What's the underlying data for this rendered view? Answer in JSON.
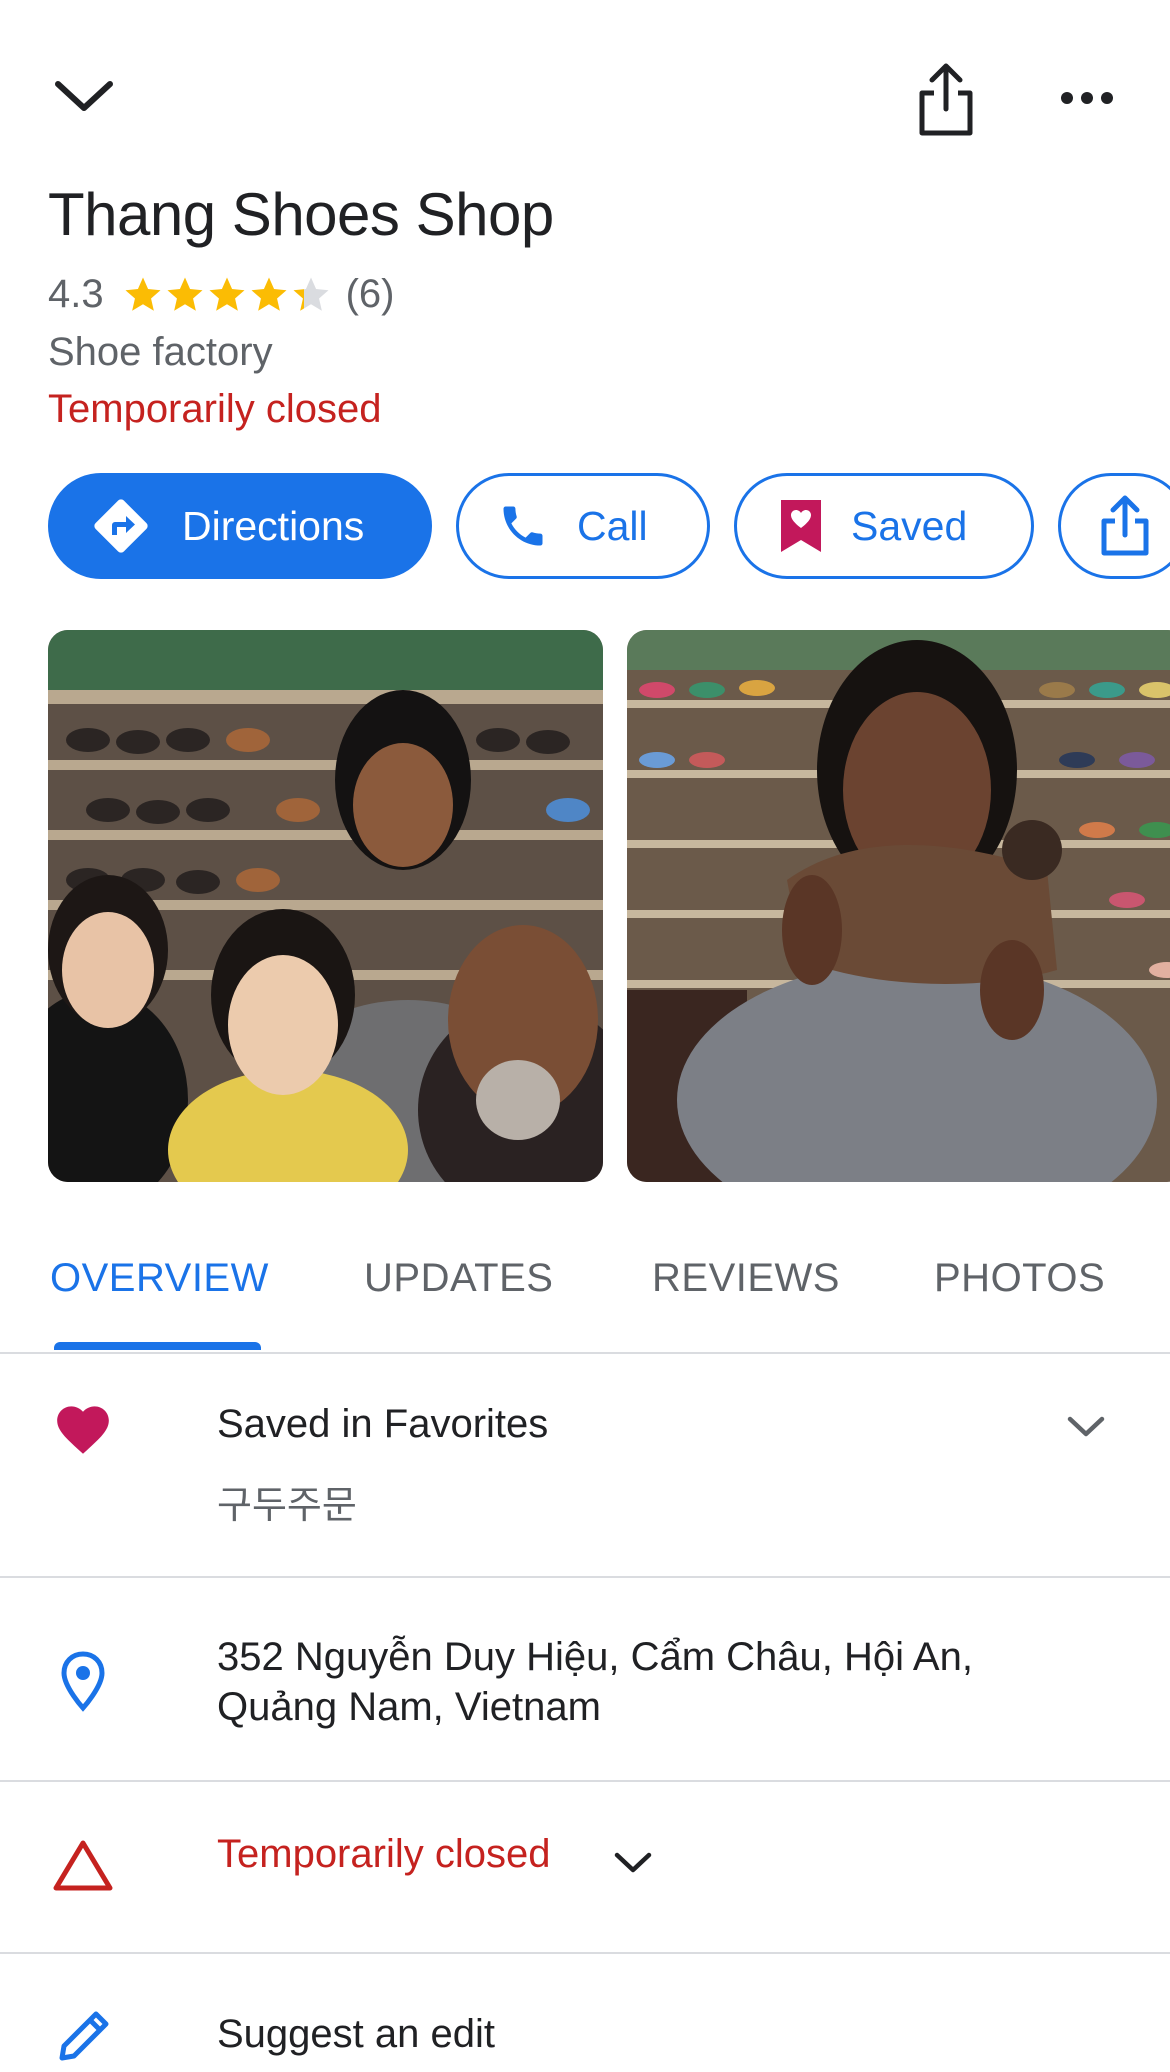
{
  "place": {
    "name": "Thang Shoes Shop",
    "rating": "4.3",
    "rating_value": 4.3,
    "rating_max": 5,
    "review_count": "(6)",
    "category": "Shoe factory",
    "status": "Temporarily closed"
  },
  "actions": {
    "directions": "Directions",
    "call": "Call",
    "saved": "Saved"
  },
  "tabs": [
    "OVERVIEW",
    "UPDATES",
    "REVIEWS",
    "PHOTOS"
  ],
  "active_tab": "OVERVIEW",
  "saved_list": {
    "title": "Saved in Favorites",
    "note": "구두주문"
  },
  "address": {
    "line1": "352 Nguyễn Duy Hiệu, Cẩm Châu, Hội An,",
    "line2": "Quảng Nam, Vietnam"
  },
  "status_row": {
    "label": "Temporarily closed"
  },
  "suggest_edit": "Suggest an edit",
  "icons": {
    "collapse": "chevron-down-icon",
    "share": "share-icon",
    "more": "more-horiz-icon",
    "directions": "directions-icon",
    "call": "phone-icon",
    "saved": "bookmark-heart-icon",
    "favorite": "heart-icon",
    "location": "location-pin-icon",
    "warning": "warning-triangle-icon",
    "edit": "pencil-icon"
  },
  "colors": {
    "accent": "#1a73e8",
    "closed": "#c5221f",
    "star": "#fbbc04",
    "favorite": "#c2185b"
  }
}
